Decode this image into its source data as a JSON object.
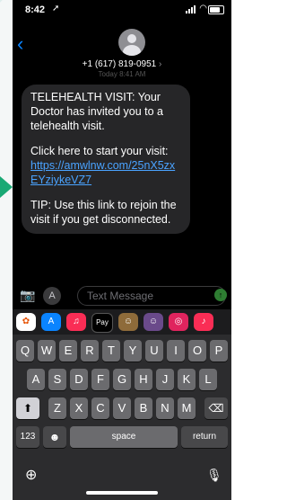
{
  "status_bar": {
    "time": "8:42",
    "location_glyph": "➚"
  },
  "header": {
    "back_glyph": "‹",
    "contact": "+1 (617) 819-0951",
    "contact_chevron": "›",
    "faded_date": "Today 8:41 AM"
  },
  "message": {
    "paragraph1": "TELEHEALTH VISIT: Your Doctor has invited you to a telehealth visit.",
    "paragraph2_prefix": "Click here to start your visit:",
    "link": "https://amwlnw.com/25nX5zxEYziykeVZ7",
    "paragraph3": "TIP: Use this link to rejoin the visit if you get disconnected."
  },
  "compose": {
    "placeholder": "Text Message",
    "send_glyph": "↑",
    "apps_glyph": "A",
    "camera_glyph": "📷"
  },
  "app_strip": [
    {
      "name": "photos-app-icon",
      "glyph": "✿",
      "color": "#ffffff"
    },
    {
      "name": "appstore-app-icon",
      "glyph": "A",
      "color": "#0a84ff"
    },
    {
      "name": "music-app-icon",
      "glyph": "♫",
      "color": "#fa2d55"
    },
    {
      "name": "applepay-app-icon",
      "glyph": "Pay",
      "color": "#000000"
    },
    {
      "name": "memoji-1-icon",
      "glyph": "☺",
      "color": "#8e6b3a"
    },
    {
      "name": "memoji-2-icon",
      "glyph": "☺",
      "color": "#6a4a8a"
    },
    {
      "name": "images-search-icon",
      "glyph": "◎",
      "color": "#e0245e"
    },
    {
      "name": "music-app-2-icon",
      "glyph": "♪",
      "color": "#fa2d55"
    }
  ],
  "keyboard": {
    "row1": [
      "Q",
      "W",
      "E",
      "R",
      "T",
      "Y",
      "U",
      "I",
      "O",
      "P"
    ],
    "row2": [
      "A",
      "S",
      "D",
      "F",
      "G",
      "H",
      "J",
      "K",
      "L"
    ],
    "row3": [
      "Z",
      "X",
      "C",
      "V",
      "B",
      "N",
      "M"
    ],
    "shift_glyph": "⬆",
    "delete_glyph": "⌫",
    "numbers_label": "123",
    "emoji_glyph": "☻",
    "space_label": "space",
    "return_label": "return",
    "globe_glyph": "⊕",
    "mic_glyph": "🎙"
  }
}
